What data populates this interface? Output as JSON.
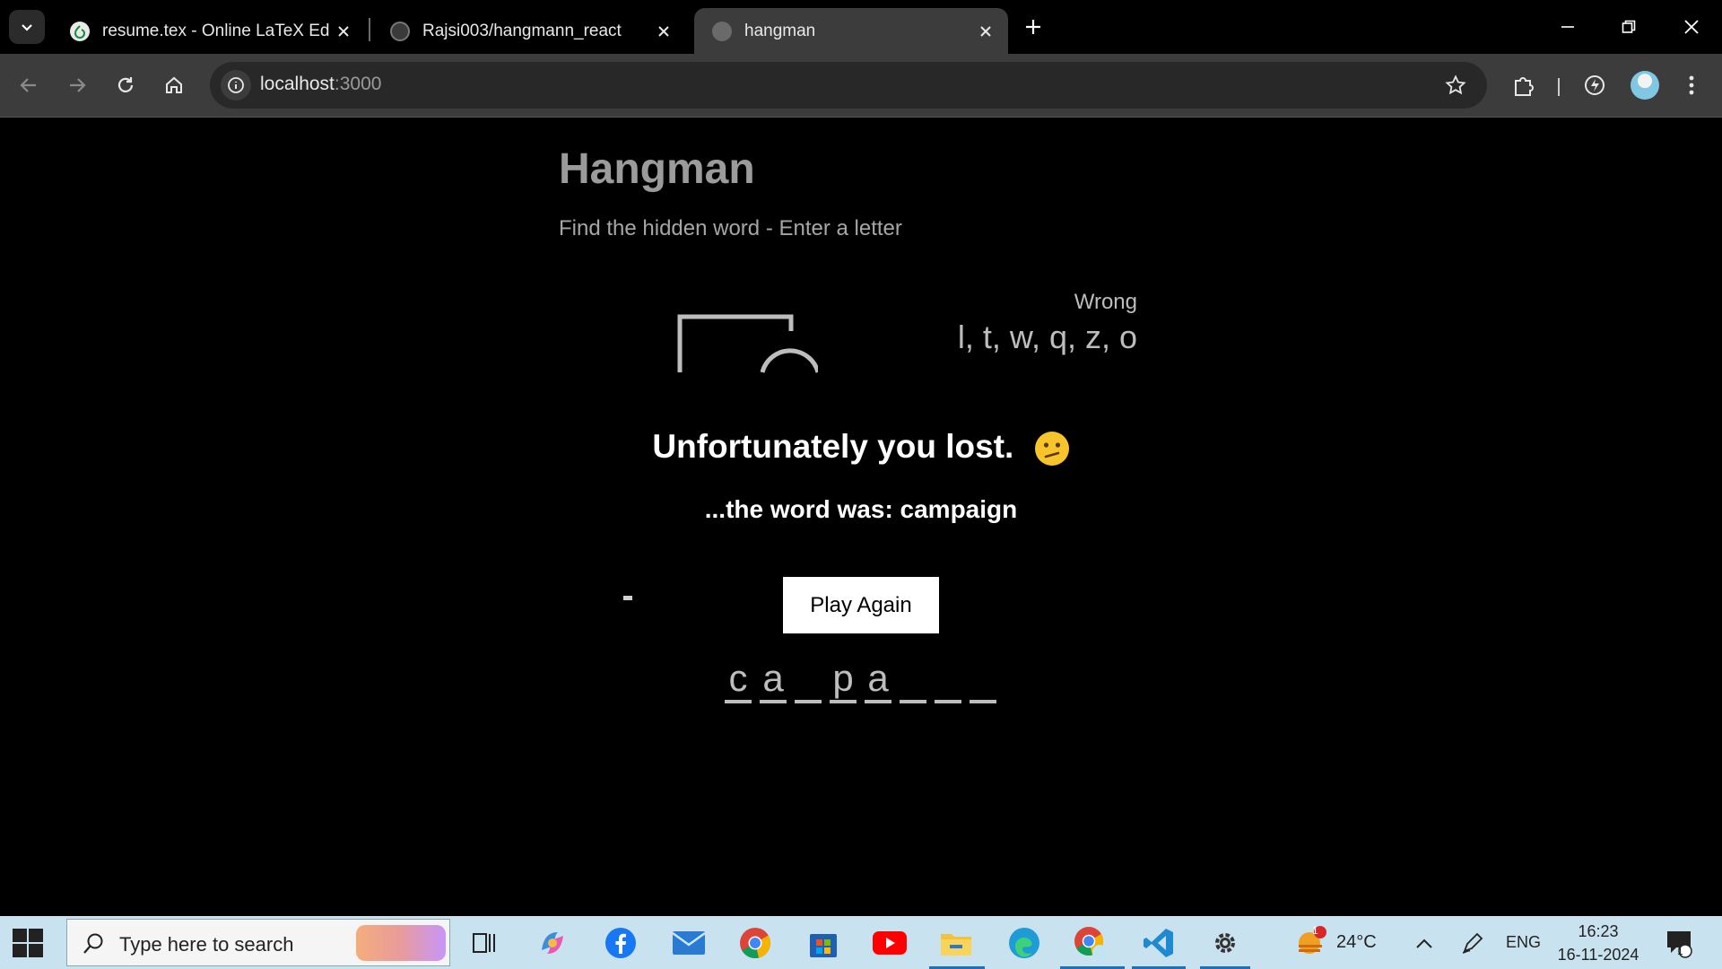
{
  "browser": {
    "tabs": [
      {
        "title": "resume.tex - Online LaTeX Edito",
        "favicon": "overleaf-icon"
      },
      {
        "title": "Rajsi003/hangmann_react",
        "favicon": "github-icon"
      },
      {
        "title": "hangman",
        "favicon": "globe-icon",
        "active": true
      }
    ],
    "url_host": "localhost",
    "url_port": ":3000"
  },
  "game": {
    "title": "Hangman",
    "subtitle": "Find the hidden word - Enter a letter",
    "wrong_label": "Wrong",
    "wrong_letters": "l, t, w, q, z, o",
    "lost_message": "Unfortunately you lost.",
    "word_reveal": "...the word was: campaign",
    "play_again": "Play Again",
    "revealed_letters": [
      "c",
      "a",
      "",
      "p",
      "a",
      "",
      "",
      ""
    ]
  },
  "taskbar": {
    "search_placeholder": "Type here to search",
    "weather": "24°C",
    "weather_badge": "1",
    "language": "ENG",
    "time": "16:23",
    "date": "16-11-2024",
    "notification_count": "1"
  },
  "colors": {
    "page_bg": "#000000",
    "chrome_bg": "#3c3c3c",
    "taskbar_bg": "#c9e2ef",
    "text_muted": "#bdbdbd"
  }
}
